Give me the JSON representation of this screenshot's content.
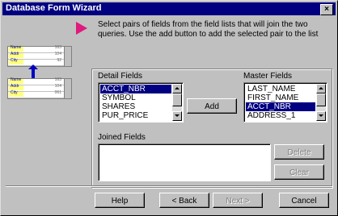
{
  "window": {
    "title": "Database Form Wizard",
    "close_glyph": "×"
  },
  "instructions": "Select pairs of fields from the field lists that will join the two queries. Use the add button to add the selected pair to the list",
  "illustration": {
    "top_rows": [
      {
        "label": "Name",
        "value": "163"
      },
      {
        "label": "Addr",
        "value": "104"
      },
      {
        "label": "City",
        "value": "92"
      }
    ],
    "bottom_rows": [
      {
        "label": "Name",
        "value": "163"
      },
      {
        "label": "Addr",
        "value": "104"
      },
      {
        "label": "City",
        "value": "061"
      }
    ]
  },
  "detail_fields": {
    "label": "Detail Fields",
    "items": [
      "ACCT_NBR",
      "SYMBOL",
      "SHARES",
      "PUR_PRICE"
    ],
    "selected_index": 0
  },
  "master_fields": {
    "label": "Master Fields",
    "items": [
      "LAST_NAME",
      "FIRST_NAME",
      "ACCT_NBR",
      "ADDRESS_1"
    ],
    "selected_index": 2
  },
  "joined_fields": {
    "label": "Joined Fields",
    "items": []
  },
  "buttons": {
    "add": "Add",
    "delete": "Delete",
    "clear": "Clear",
    "help": "Help",
    "back": "< Back",
    "next": "Next >",
    "cancel": "Cancel"
  },
  "colors": {
    "titlebar": "#000080",
    "selection": "#000080",
    "pointer": "#e0197e",
    "face": "#c0c0c0"
  }
}
